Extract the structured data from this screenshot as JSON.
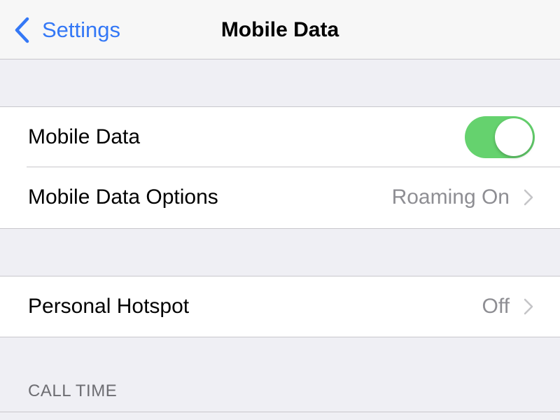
{
  "nav": {
    "back_label": "Settings",
    "title": "Mobile Data"
  },
  "group1": {
    "mobile_data": {
      "label": "Mobile Data",
      "enabled": true
    },
    "options": {
      "label": "Mobile Data Options",
      "value": "Roaming On"
    }
  },
  "group2": {
    "hotspot": {
      "label": "Personal Hotspot",
      "value": "Off"
    }
  },
  "section": {
    "call_time_header": "CALL TIME"
  },
  "colors": {
    "accent": "#3478f6",
    "toggle_on": "#65d26e",
    "background": "#efeff4",
    "secondary_text": "#8e8e93"
  },
  "icons": {
    "back": "chevron-left-icon",
    "disclosure": "chevron-right-icon"
  }
}
